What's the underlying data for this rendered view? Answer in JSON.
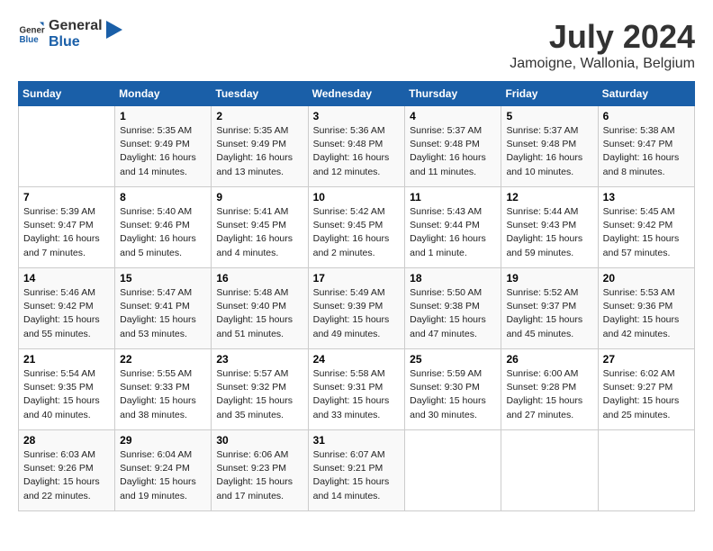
{
  "header": {
    "logo_general": "General",
    "logo_blue": "Blue",
    "month_year": "July 2024",
    "location": "Jamoigne, Wallonia, Belgium"
  },
  "weekdays": [
    "Sunday",
    "Monday",
    "Tuesday",
    "Wednesday",
    "Thursday",
    "Friday",
    "Saturday"
  ],
  "weeks": [
    [
      {
        "day": "",
        "sunrise": "",
        "sunset": "",
        "daylight": ""
      },
      {
        "day": "1",
        "sunrise": "Sunrise: 5:35 AM",
        "sunset": "Sunset: 9:49 PM",
        "daylight": "Daylight: 16 hours and 14 minutes."
      },
      {
        "day": "2",
        "sunrise": "Sunrise: 5:35 AM",
        "sunset": "Sunset: 9:49 PM",
        "daylight": "Daylight: 16 hours and 13 minutes."
      },
      {
        "day": "3",
        "sunrise": "Sunrise: 5:36 AM",
        "sunset": "Sunset: 9:48 PM",
        "daylight": "Daylight: 16 hours and 12 minutes."
      },
      {
        "day": "4",
        "sunrise": "Sunrise: 5:37 AM",
        "sunset": "Sunset: 9:48 PM",
        "daylight": "Daylight: 16 hours and 11 minutes."
      },
      {
        "day": "5",
        "sunrise": "Sunrise: 5:37 AM",
        "sunset": "Sunset: 9:48 PM",
        "daylight": "Daylight: 16 hours and 10 minutes."
      },
      {
        "day": "6",
        "sunrise": "Sunrise: 5:38 AM",
        "sunset": "Sunset: 9:47 PM",
        "daylight": "Daylight: 16 hours and 8 minutes."
      }
    ],
    [
      {
        "day": "7",
        "sunrise": "Sunrise: 5:39 AM",
        "sunset": "Sunset: 9:47 PM",
        "daylight": "Daylight: 16 hours and 7 minutes."
      },
      {
        "day": "8",
        "sunrise": "Sunrise: 5:40 AM",
        "sunset": "Sunset: 9:46 PM",
        "daylight": "Daylight: 16 hours and 5 minutes."
      },
      {
        "day": "9",
        "sunrise": "Sunrise: 5:41 AM",
        "sunset": "Sunset: 9:45 PM",
        "daylight": "Daylight: 16 hours and 4 minutes."
      },
      {
        "day": "10",
        "sunrise": "Sunrise: 5:42 AM",
        "sunset": "Sunset: 9:45 PM",
        "daylight": "Daylight: 16 hours and 2 minutes."
      },
      {
        "day": "11",
        "sunrise": "Sunrise: 5:43 AM",
        "sunset": "Sunset: 9:44 PM",
        "daylight": "Daylight: 16 hours and 1 minute."
      },
      {
        "day": "12",
        "sunrise": "Sunrise: 5:44 AM",
        "sunset": "Sunset: 9:43 PM",
        "daylight": "Daylight: 15 hours and 59 minutes."
      },
      {
        "day": "13",
        "sunrise": "Sunrise: 5:45 AM",
        "sunset": "Sunset: 9:42 PM",
        "daylight": "Daylight: 15 hours and 57 minutes."
      }
    ],
    [
      {
        "day": "14",
        "sunrise": "Sunrise: 5:46 AM",
        "sunset": "Sunset: 9:42 PM",
        "daylight": "Daylight: 15 hours and 55 minutes."
      },
      {
        "day": "15",
        "sunrise": "Sunrise: 5:47 AM",
        "sunset": "Sunset: 9:41 PM",
        "daylight": "Daylight: 15 hours and 53 minutes."
      },
      {
        "day": "16",
        "sunrise": "Sunrise: 5:48 AM",
        "sunset": "Sunset: 9:40 PM",
        "daylight": "Daylight: 15 hours and 51 minutes."
      },
      {
        "day": "17",
        "sunrise": "Sunrise: 5:49 AM",
        "sunset": "Sunset: 9:39 PM",
        "daylight": "Daylight: 15 hours and 49 minutes."
      },
      {
        "day": "18",
        "sunrise": "Sunrise: 5:50 AM",
        "sunset": "Sunset: 9:38 PM",
        "daylight": "Daylight: 15 hours and 47 minutes."
      },
      {
        "day": "19",
        "sunrise": "Sunrise: 5:52 AM",
        "sunset": "Sunset: 9:37 PM",
        "daylight": "Daylight: 15 hours and 45 minutes."
      },
      {
        "day": "20",
        "sunrise": "Sunrise: 5:53 AM",
        "sunset": "Sunset: 9:36 PM",
        "daylight": "Daylight: 15 hours and 42 minutes."
      }
    ],
    [
      {
        "day": "21",
        "sunrise": "Sunrise: 5:54 AM",
        "sunset": "Sunset: 9:35 PM",
        "daylight": "Daylight: 15 hours and 40 minutes."
      },
      {
        "day": "22",
        "sunrise": "Sunrise: 5:55 AM",
        "sunset": "Sunset: 9:33 PM",
        "daylight": "Daylight: 15 hours and 38 minutes."
      },
      {
        "day": "23",
        "sunrise": "Sunrise: 5:57 AM",
        "sunset": "Sunset: 9:32 PM",
        "daylight": "Daylight: 15 hours and 35 minutes."
      },
      {
        "day": "24",
        "sunrise": "Sunrise: 5:58 AM",
        "sunset": "Sunset: 9:31 PM",
        "daylight": "Daylight: 15 hours and 33 minutes."
      },
      {
        "day": "25",
        "sunrise": "Sunrise: 5:59 AM",
        "sunset": "Sunset: 9:30 PM",
        "daylight": "Daylight: 15 hours and 30 minutes."
      },
      {
        "day": "26",
        "sunrise": "Sunrise: 6:00 AM",
        "sunset": "Sunset: 9:28 PM",
        "daylight": "Daylight: 15 hours and 27 minutes."
      },
      {
        "day": "27",
        "sunrise": "Sunrise: 6:02 AM",
        "sunset": "Sunset: 9:27 PM",
        "daylight": "Daylight: 15 hours and 25 minutes."
      }
    ],
    [
      {
        "day": "28",
        "sunrise": "Sunrise: 6:03 AM",
        "sunset": "Sunset: 9:26 PM",
        "daylight": "Daylight: 15 hours and 22 minutes."
      },
      {
        "day": "29",
        "sunrise": "Sunrise: 6:04 AM",
        "sunset": "Sunset: 9:24 PM",
        "daylight": "Daylight: 15 hours and 19 minutes."
      },
      {
        "day": "30",
        "sunrise": "Sunrise: 6:06 AM",
        "sunset": "Sunset: 9:23 PM",
        "daylight": "Daylight: 15 hours and 17 minutes."
      },
      {
        "day": "31",
        "sunrise": "Sunrise: 6:07 AM",
        "sunset": "Sunset: 9:21 PM",
        "daylight": "Daylight: 15 hours and 14 minutes."
      },
      {
        "day": "",
        "sunrise": "",
        "sunset": "",
        "daylight": ""
      },
      {
        "day": "",
        "sunrise": "",
        "sunset": "",
        "daylight": ""
      },
      {
        "day": "",
        "sunrise": "",
        "sunset": "",
        "daylight": ""
      }
    ]
  ]
}
